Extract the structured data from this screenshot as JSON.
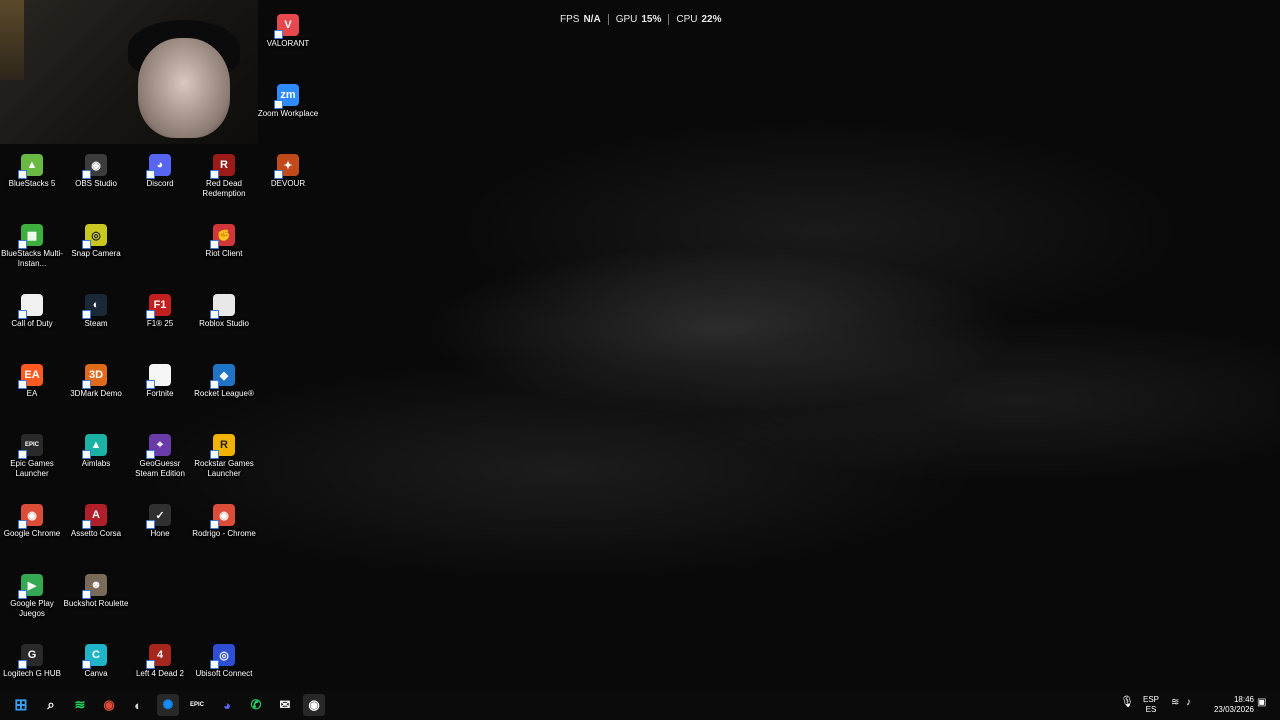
{
  "overlay": {
    "fps_label": "FPS",
    "fps_value": "N/A",
    "gpu_label": "GPU",
    "gpu_value": "15%",
    "cpu_label": "CPU",
    "cpu_value": "22%"
  },
  "desktop_icons": [
    {
      "label": "VALORANT",
      "color": "#e5484d",
      "glyph": "V"
    },
    {
      "label": "Zoom Workplace",
      "color": "#2d8cff",
      "glyph": "zm"
    },
    {
      "label": "BlueStacks 5",
      "color": "#69b944",
      "glyph": "▲"
    },
    {
      "label": "OBS Studio",
      "color": "#3c3c3c",
      "glyph": "◉"
    },
    {
      "label": "Discord",
      "color": "#5865f2",
      "glyph": "◕"
    },
    {
      "label": "Red Dead Redemption",
      "color": "#9b1b1b",
      "glyph": "R"
    },
    {
      "label": "DEVOUR",
      "color": "#c04a1a",
      "glyph": "✦"
    },
    {
      "label": "BlueStacks Multi-Instan...",
      "color": "#3fae3f",
      "glyph": "▦"
    },
    {
      "label": "Snap Camera",
      "color": "#c8c820",
      "glyph": "◎"
    },
    {
      "label": "Riot Client",
      "color": "#d13639",
      "glyph": "✊"
    },
    {
      "label": "Call of Duty",
      "color": "#f0f0f0",
      "glyph": ""
    },
    {
      "label": "Steam",
      "color": "#1b2838",
      "glyph": "◐"
    },
    {
      "label": "F1® 25",
      "color": "#c21f1f",
      "glyph": "F1"
    },
    {
      "label": "Roblox Studio",
      "color": "#e8e8e8",
      "glyph": ""
    },
    {
      "label": "EA",
      "color": "#ff5a1f",
      "glyph": "EA"
    },
    {
      "label": "3DMark Demo",
      "color": "#e06a1c",
      "glyph": "3D"
    },
    {
      "label": "Fortnite",
      "color": "#f5f5f5",
      "glyph": ""
    },
    {
      "label": "Rocket League®",
      "color": "#1f74c8",
      "glyph": "◆"
    },
    {
      "label": "Epic Games Launcher",
      "color": "#2a2a2a",
      "glyph": "EPIC"
    },
    {
      "label": "Aimlabs",
      "color": "#1bb3a3",
      "glyph": "▲"
    },
    {
      "label": "GeoGuessr Steam Edition",
      "color": "#6a3aa8",
      "glyph": "⌖"
    },
    {
      "label": "Rockstar Games Launcher",
      "color": "#f2b300",
      "glyph": "R"
    },
    {
      "label": "Google Chrome",
      "color": "#dd4b39",
      "glyph": "◉"
    },
    {
      "label": "Assetto Corsa",
      "color": "#b01f2a",
      "glyph": "A"
    },
    {
      "label": "Hone",
      "color": "#303030",
      "glyph": "✓"
    },
    {
      "label": "Rodrigo - Chrome",
      "color": "#dd4b39",
      "glyph": "◉"
    },
    {
      "label": "Google Play Juegos",
      "color": "#34a853",
      "glyph": "▶"
    },
    {
      "label": "Buckshot Roulette",
      "color": "#7a6a5a",
      "glyph": "☻"
    },
    {
      "label": "Logitech G HUB",
      "color": "#2a2a2a",
      "glyph": "G"
    },
    {
      "label": "Canva",
      "color": "#1fb4c8",
      "glyph": "C"
    },
    {
      "label": "Left 4 Dead 2",
      "color": "#a4261d",
      "glyph": "4"
    },
    {
      "label": "Ubisoft Connect",
      "color": "#2e4fd4",
      "glyph": "◎"
    }
  ],
  "taskbar": {
    "items": [
      {
        "name": "start-button",
        "glyph": "⊞",
        "color": "#3a9bf0"
      },
      {
        "name": "search-icon",
        "glyph": "⌕",
        "color": "#ffffff"
      },
      {
        "name": "spotify-icon",
        "glyph": "≋",
        "color": "#1ed760"
      },
      {
        "name": "chrome-icon",
        "glyph": "◉",
        "color": "#dd4b39"
      },
      {
        "name": "steam-icon",
        "glyph": "◐",
        "color": "#c7d5e0"
      },
      {
        "name": "battlenet-icon",
        "glyph": "✺",
        "color": "#148eff"
      },
      {
        "name": "epic-icon",
        "glyph": "EPIC",
        "color": "#ffffff"
      },
      {
        "name": "discord-icon",
        "glyph": "◕",
        "color": "#5865f2"
      },
      {
        "name": "whatsapp-icon",
        "glyph": "✆",
        "color": "#25d366"
      },
      {
        "name": "mail-icon",
        "glyph": "✉",
        "color": "#ffffff"
      },
      {
        "name": "obs-icon",
        "glyph": "◉",
        "color": "#ffffff"
      }
    ],
    "lang_top": "ESP",
    "lang_bottom": "ES",
    "time": "18:46",
    "date": "23/03/2026"
  }
}
